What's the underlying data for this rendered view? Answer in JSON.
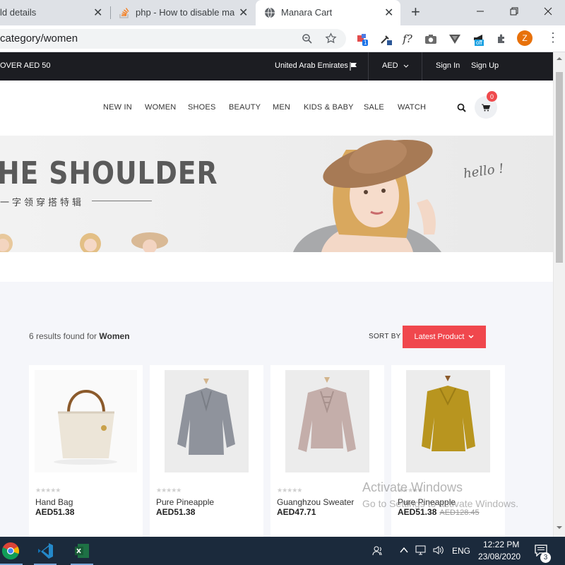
{
  "browser": {
    "tabs": [
      {
        "title": "ld details",
        "close": "✕"
      },
      {
        "title": "php - How to disable ma",
        "close": "✕"
      },
      {
        "title": "Manara Cart",
        "close": "✕"
      }
    ],
    "new_tab": "+",
    "url": "category/women",
    "profile_initial": "Z",
    "ext_badge_1": "1",
    "ext_badge_off": "off",
    "ext_f": "f?"
  },
  "site": {
    "promo": "OVER AED 50",
    "country": "United Arab Emirates",
    "currency": "AED",
    "sign_in": "Sign In",
    "sign_up": "Sign Up",
    "nav": [
      "NEW IN",
      "WOMEN",
      "SHOES",
      "BEAUTY",
      "MEN",
      "KIDS & BABY",
      "SALE",
      "WATCH"
    ],
    "cart_count": "0",
    "hero": {
      "title": "HE SHOULDER",
      "subtitle": "一字领穿搭特辑",
      "hello": "hello !"
    },
    "results_prefix": "6 results found for",
    "results_term": "Women",
    "sort_label": "SORT BY",
    "sort_value": "Latest Product",
    "products": [
      {
        "name": "Hand Bag",
        "price": "AED51.38",
        "old_price": "",
        "rating": 0
      },
      {
        "name": "Pure Pineapple",
        "price": "AED51.38",
        "old_price": "",
        "rating": 0
      },
      {
        "name": "Guanghzou Sweater",
        "price": "AED47.71",
        "old_price": "",
        "rating": 0
      },
      {
        "name": "Pure Pineapple",
        "price": "AED51.38",
        "old_price": "AED128.45",
        "rating": 0
      }
    ],
    "stars": "★★★★★"
  },
  "windows": {
    "activate_title": "Activate Windows",
    "activate_sub": "Go to Settings to activate Windows.",
    "time": "12:22 PM",
    "date": "23/08/2020",
    "lang": "ENG",
    "notif_count": "3"
  },
  "colors": {
    "accent": "#f0474d",
    "topbar": "#1c1d22",
    "taskbar": "#1b2a3c"
  }
}
